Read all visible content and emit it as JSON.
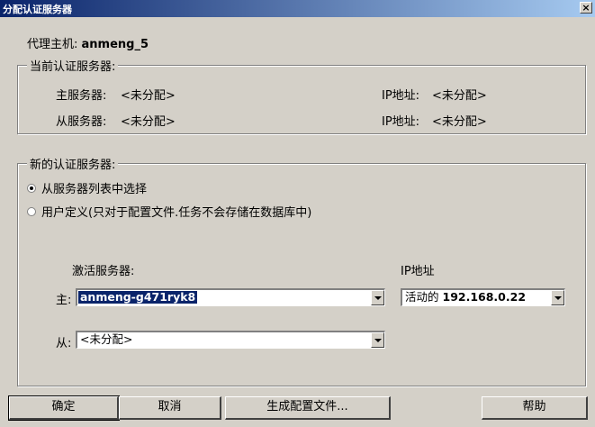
{
  "window": {
    "title": "分配认证服务器",
    "close_label": "×"
  },
  "agent": {
    "label": "代理主机:",
    "value": "anmeng_5"
  },
  "current": {
    "legend": "当前认证服务器:",
    "primary_label": "主服务器:",
    "primary_value": "<未分配>",
    "primary_ip_label": "IP地址:",
    "primary_ip_value": "<未分配>",
    "secondary_label": "从服务器:",
    "secondary_value": "<未分配>",
    "secondary_ip_label": "IP地址:",
    "secondary_ip_value": "<未分配>"
  },
  "new_servers": {
    "legend": "新的认证服务器:",
    "radio_list": {
      "label": "从服务器列表中选择",
      "checked": true
    },
    "radio_custom": {
      "label": "用户定义(只对于配置文件.任务不会存储在数据库中)",
      "checked": false
    },
    "active_servers_header": "激活服务器:",
    "ip_header": "IP地址",
    "primary_label": "主:",
    "primary_selected": "anmeng-g471ryk8",
    "ip_state": "活动的",
    "ip_value": "192.168.0.22",
    "secondary_label": "从:",
    "secondary_selected": "<未分配>"
  },
  "buttons": {
    "ok": "确定",
    "cancel": "取消",
    "generate": "生成配置文件...",
    "help": "帮助"
  }
}
